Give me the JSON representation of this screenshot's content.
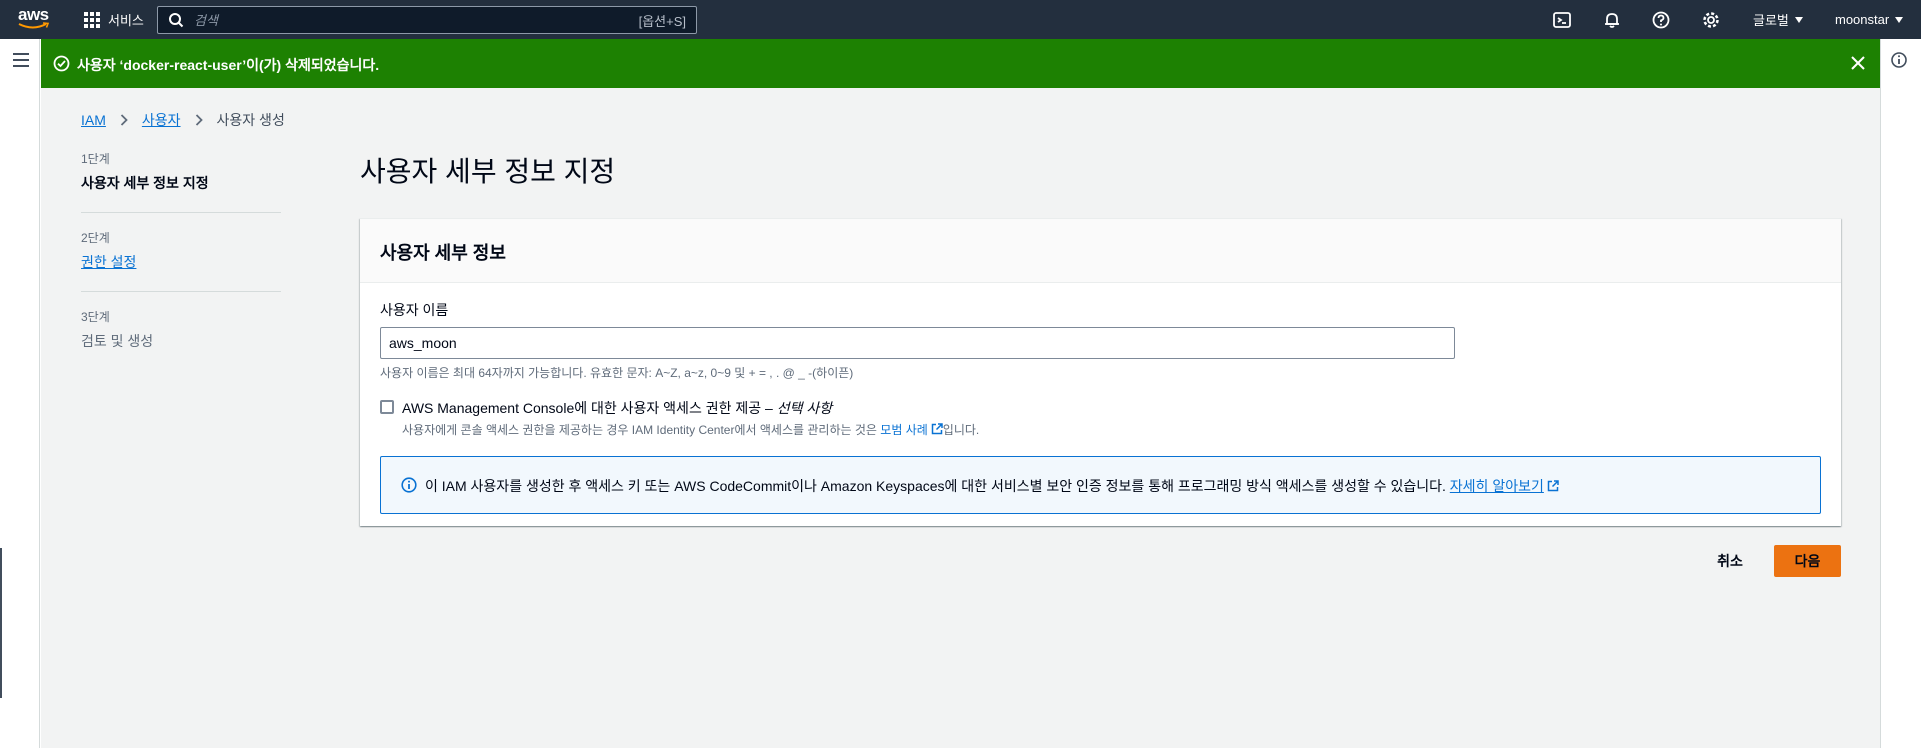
{
  "topnav": {
    "logo_text": "aws",
    "services_label": "서비스",
    "search_placeholder": "검색",
    "search_shortcut": "[옵션+S]",
    "region_label": "글로벌",
    "account_label": "moonstar",
    "icons": [
      "cloudshell-icon",
      "bell-icon",
      "help-icon",
      "gear-icon"
    ]
  },
  "flash": {
    "message": "사용자 ‘docker-react-user’이(가) 삭제되었습니다.",
    "color": "#1d8102"
  },
  "breadcrumb": {
    "items": [
      "IAM",
      "사용자"
    ],
    "current": "사용자 생성"
  },
  "steps": [
    {
      "number": "1단계",
      "label": "사용자 세부 정보 지정"
    },
    {
      "number": "2단계",
      "label": "권한 설정"
    },
    {
      "number": "3단계",
      "label": "검토 및 생성"
    }
  ],
  "page": {
    "title": "사용자 세부 정보 지정"
  },
  "container": {
    "header": "사용자 세부 정보",
    "username_label": "사용자 이름",
    "username_value": "aws_moon",
    "username_hint": "사용자 이름은 최대 64자까지 가능합니다. 유효한 문자: A~Z, a~z, 0~9 및 + = , . @ _ -(하이픈)",
    "console_access_label": "AWS Management Console에 대한 사용자 액세스 권한 제공 – ",
    "console_access_optional": "선택 사항",
    "console_access_desc_prefix": "사용자에게 콘솔 액세스 권한을 제공하는 경우 IAM Identity Center에서 액세스를 관리하는 것은 ",
    "console_access_desc_link": "모범 사례",
    "console_access_desc_suffix": "입니다.",
    "console_access_checked": false,
    "info_text": "이 IAM 사용자를 생성한 후 액세스 키 또는 AWS CodeCommit이나 Amazon Keyspaces에 대한 서비스별 보안 인증 정보를 통해 프로그래밍 방식 액세스를 생성할 수 있습니다. ",
    "info_link": "자세히 알아보기"
  },
  "actions": {
    "cancel_label": "취소",
    "next_label": "다음",
    "primary_color": "#ec7211"
  }
}
